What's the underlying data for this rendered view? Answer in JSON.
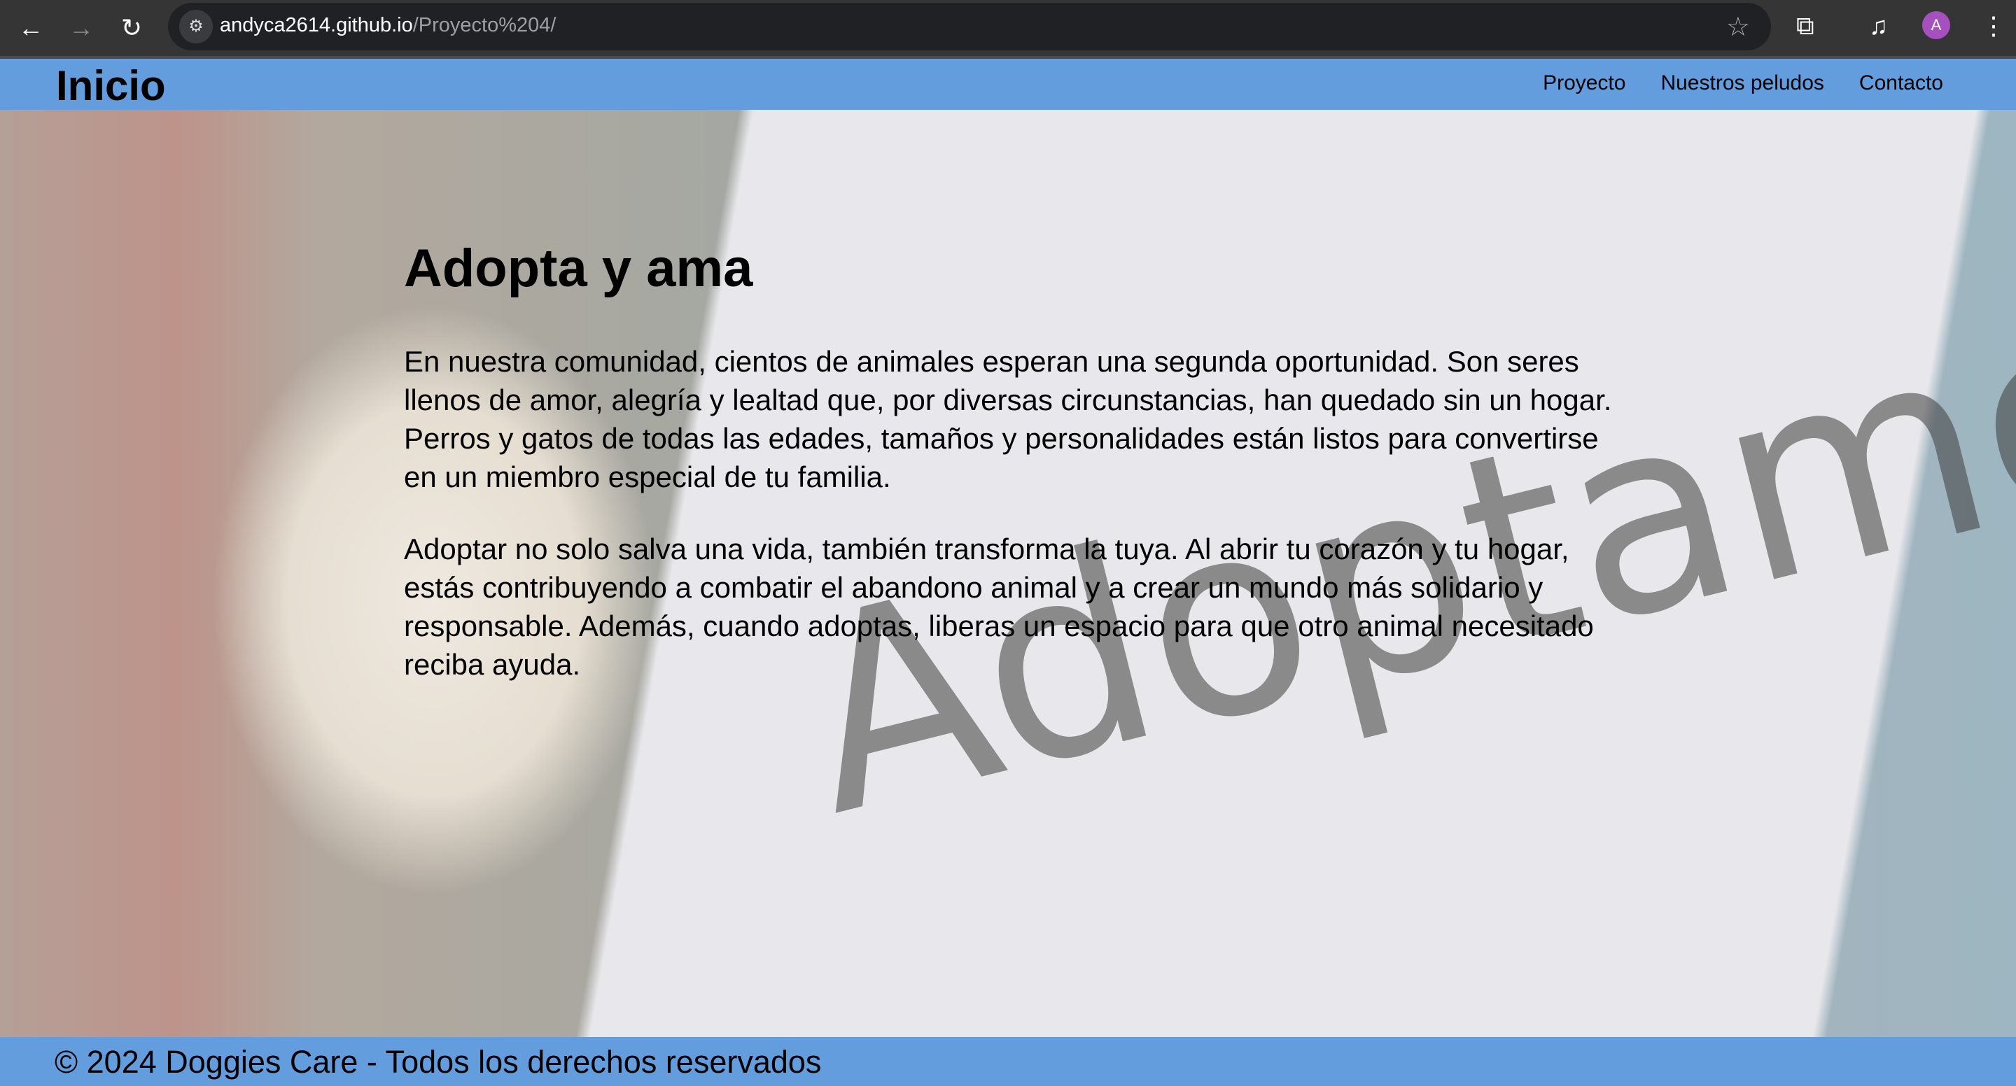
{
  "browser": {
    "url_domain": "andyca2614.github.io",
    "url_path": "/Proyecto%204/",
    "avatar_letter": "A"
  },
  "header": {
    "logo": "Inicio",
    "nav": [
      "Proyecto",
      "Nuestros peludos",
      "Contacto"
    ]
  },
  "hero": {
    "sign_text": "Adoptame",
    "title": "Adopta y ama",
    "paragraphs": [
      "En nuestra comunidad, cientos de animales esperan una segunda oportunidad. Son seres llenos de amor, alegría y lealtad que, por diversas circunstancias, han quedado sin un hogar. Perros y gatos de todas las edades, tamaños y personalidades están listos para convertirse en un miembro especial de tu familia.",
      "Adoptar no solo salva una vida, también transforma la tuya. Al abrir tu corazón y tu hogar, estás contribuyendo a combatir el abandono animal y a crear un mundo más solidario y responsable. Además, cuando adoptas, liberas un espacio para que otro animal necesitado reciba ayuda."
    ]
  },
  "footer": {
    "text": "© 2024 Doggies Care - Todos los derechos reservados"
  },
  "colors": {
    "header": "#649ddd",
    "chrome": "#353535"
  }
}
